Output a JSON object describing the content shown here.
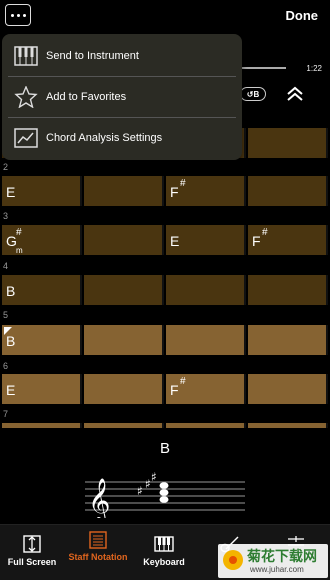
{
  "topbar": {
    "done_label": "Done"
  },
  "player": {
    "time": "1:22",
    "loop_label": "B"
  },
  "menu": {
    "items": [
      {
        "label": "Send to Instrument",
        "icon": "piano-keys-icon"
      },
      {
        "label": "Add to Favorites",
        "icon": "star-icon"
      },
      {
        "label": "Chord Analysis Settings",
        "icon": "chart-settings-icon"
      }
    ]
  },
  "grid": {
    "bars": [
      {
        "number": "2",
        "cells": [
          {
            "root": "E",
            "sharp": "",
            "sub": ""
          },
          {
            "root": "",
            "sharp": "",
            "sub": ""
          },
          {
            "root": "F",
            "sharp": "#",
            "sub": ""
          },
          {
            "root": "",
            "sharp": "",
            "sub": ""
          }
        ]
      },
      {
        "number": "3",
        "cells": [
          {
            "root": "G",
            "sharp": "#",
            "sub": "m"
          },
          {
            "root": "",
            "sharp": "",
            "sub": ""
          },
          {
            "root": "E",
            "sharp": "",
            "sub": ""
          },
          {
            "root": "F",
            "sharp": "#",
            "sub": ""
          }
        ]
      },
      {
        "number": "4",
        "cells": [
          {
            "root": "B",
            "sharp": "",
            "sub": ""
          },
          {
            "root": "",
            "sharp": "",
            "sub": ""
          },
          {
            "root": "",
            "sharp": "",
            "sub": ""
          },
          {
            "root": "",
            "sharp": "",
            "sub": ""
          }
        ]
      },
      {
        "number": "5",
        "cells": [
          {
            "root": "B",
            "sharp": "",
            "sub": ""
          },
          {
            "root": "",
            "sharp": "",
            "sub": ""
          },
          {
            "root": "",
            "sharp": "",
            "sub": ""
          },
          {
            "root": "",
            "sharp": "",
            "sub": ""
          }
        ]
      },
      {
        "number": "6",
        "cells": [
          {
            "root": "E",
            "sharp": "",
            "sub": ""
          },
          {
            "root": "",
            "sharp": "",
            "sub": ""
          },
          {
            "root": "F",
            "sharp": "#",
            "sub": ""
          },
          {
            "root": "",
            "sharp": "",
            "sub": ""
          }
        ]
      },
      {
        "number": "7",
        "cells": []
      }
    ]
  },
  "chord_display": {
    "current_chord": "B"
  },
  "tabs": [
    {
      "label": "Full Screen",
      "icon": "fullscreen-icon"
    },
    {
      "label": "Staff Notation",
      "icon": "staff-notation-icon",
      "active": true
    },
    {
      "label": "Keyboard",
      "icon": "keyboard-icon"
    },
    {
      "label": "",
      "icon": "guitar-icon"
    },
    {
      "label": "",
      "icon": "sliders-icon"
    }
  ],
  "watermark": {
    "brand": "菊花下载网",
    "url": "www.juhar.com"
  },
  "colors": {
    "dark_cell": "#4a3510",
    "light_cell": "#866332",
    "accent": "#e0651e",
    "menu_bg": "#2b2b24"
  }
}
